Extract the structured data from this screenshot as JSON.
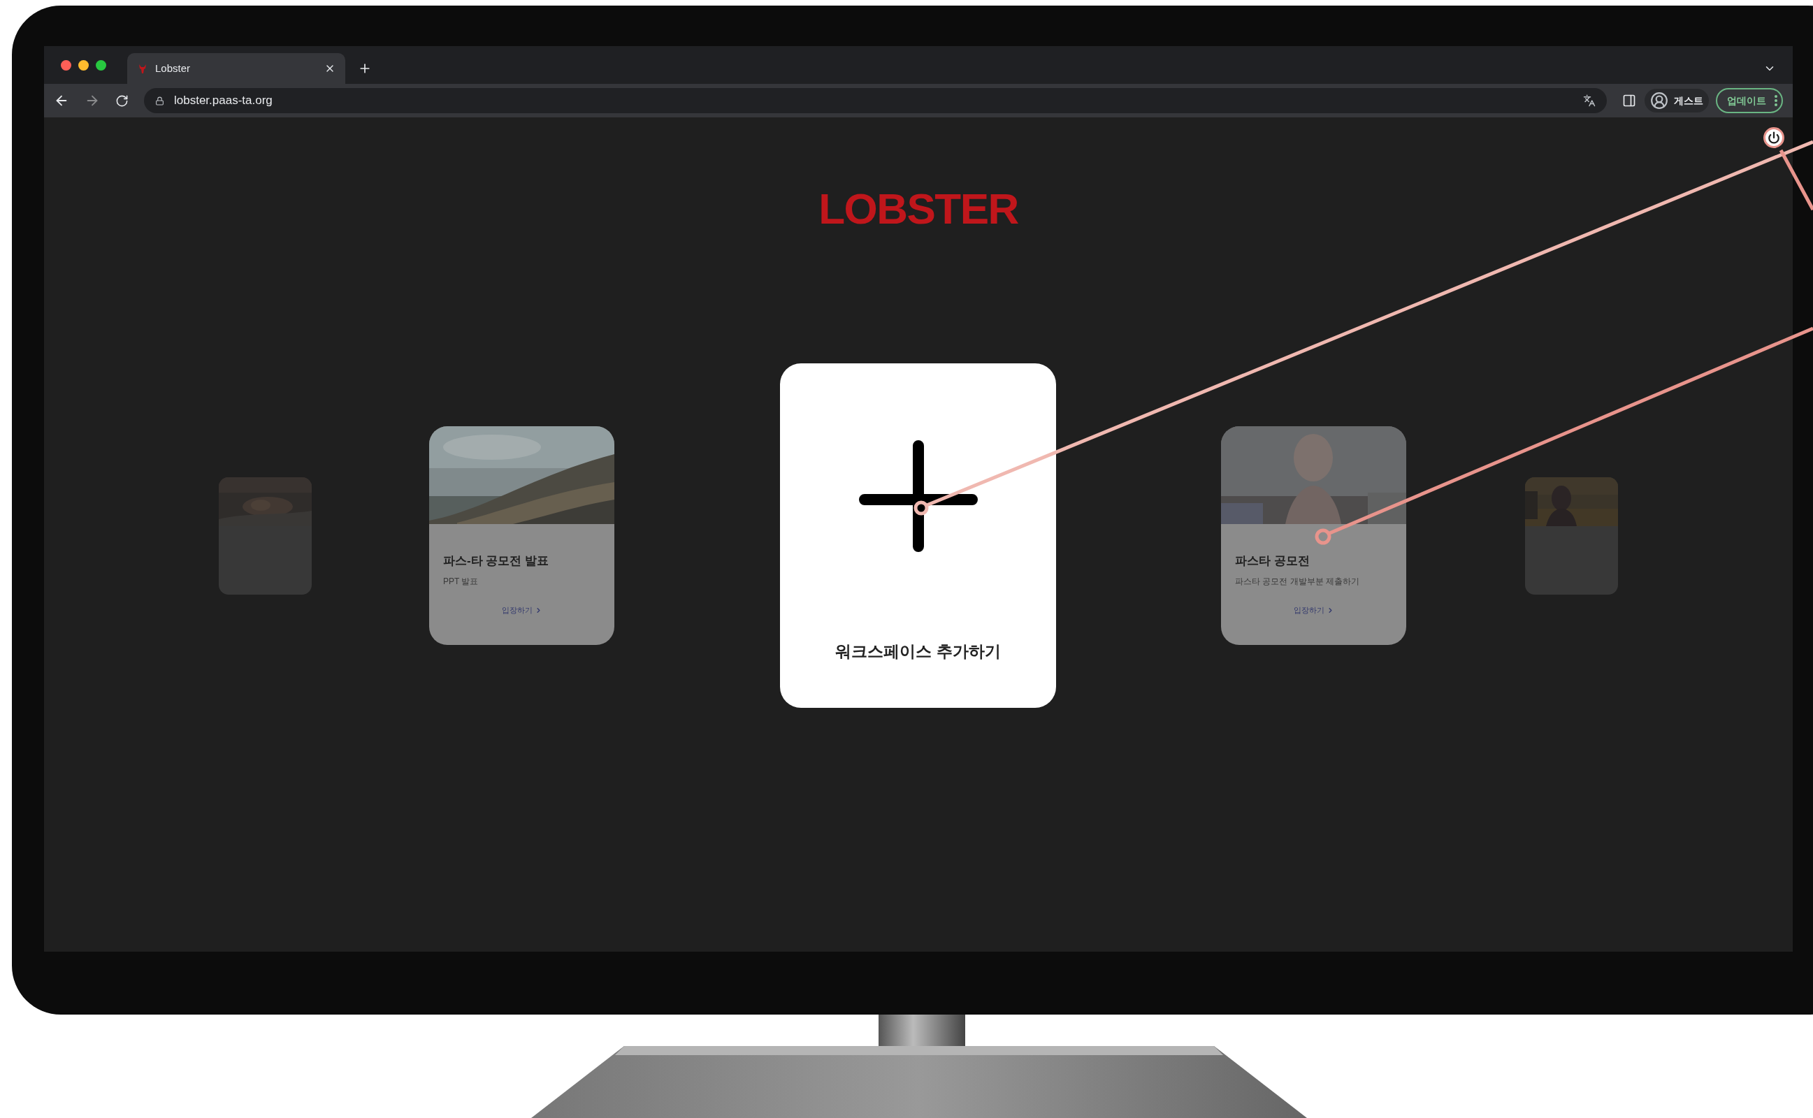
{
  "browser": {
    "tab": {
      "title": "Lobster"
    },
    "url": "lobster.paas-ta.org",
    "profile": "게스트",
    "update": "업데이트"
  },
  "page": {
    "logo": "LOBSTER",
    "add_card": {
      "label": "워크스페이스 추가하기"
    },
    "workspaces": [
      {
        "kind": "faded"
      },
      {
        "kind": "card",
        "title": "파스-타 공모전 발표",
        "description": "PPT 발표",
        "action": "입장하기"
      },
      {
        "kind": "add"
      },
      {
        "kind": "card",
        "title": "파스타 공모전",
        "description": "파스타 공모전 개발부분 제출하기",
        "action": "입장하기"
      },
      {
        "kind": "faded"
      }
    ]
  }
}
